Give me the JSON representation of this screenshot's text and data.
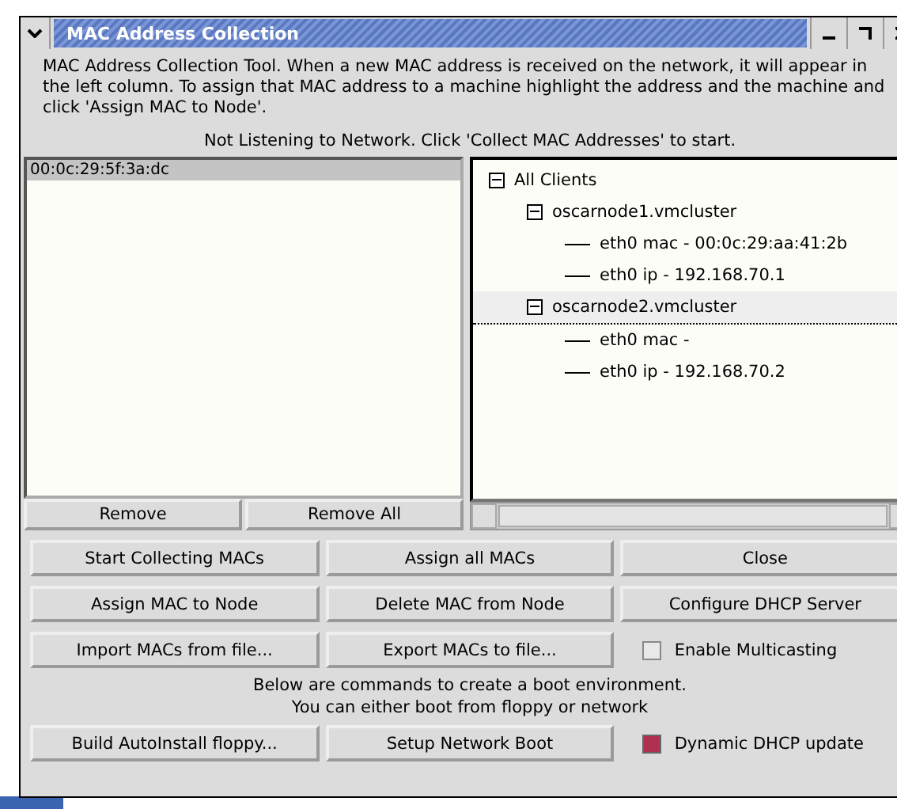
{
  "window": {
    "title": "MAC Address Collection"
  },
  "intro": "MAC Address Collection Tool.  When a new MAC address is received on the network, it will appear in the left column.  To assign that MAC address to a machine highlight the address and the machine and click 'Assign MAC to Node'.",
  "status": "Not Listening to Network. Click 'Collect MAC Addresses' to start.",
  "mac_list": [
    {
      "label": "00:0c:29:5f:3a:dc",
      "selected": true
    }
  ],
  "list_buttons": [
    "Remove",
    "Remove All"
  ],
  "tree": [
    {
      "label": "All Clients",
      "expanded": true,
      "selected": false,
      "children": [
        {
          "label": "oscarnode1.vmcluster",
          "expanded": true,
          "selected": false,
          "children": [
            {
              "label": "eth0 mac - 00:0c:29:aa:41:2b",
              "selected": false
            },
            {
              "label": "eth0 ip - 192.168.70.1",
              "selected": false
            }
          ]
        },
        {
          "label": "oscarnode2.vmcluster",
          "expanded": true,
          "selected": true,
          "children": [
            {
              "label": "eth0 mac -",
              "selected": false
            },
            {
              "label": "eth0 ip - 192.168.70.2",
              "selected": false
            }
          ]
        }
      ]
    }
  ],
  "grid": [
    {
      "kind": "button",
      "label": "Start Collecting MACs"
    },
    {
      "kind": "button",
      "label": "Assign all MACs"
    },
    {
      "kind": "button",
      "label": "Close"
    },
    {
      "kind": "button",
      "label": "Assign MAC to Node"
    },
    {
      "kind": "button",
      "label": "Delete MAC from Node"
    },
    {
      "kind": "button",
      "label": "Configure DHCP Server"
    },
    {
      "kind": "button",
      "label": "Import MACs from file..."
    },
    {
      "kind": "button",
      "label": "Export MACs to file..."
    },
    {
      "kind": "checkbox",
      "label": "Enable Multicasting",
      "checked": false
    }
  ],
  "boot_note": [
    "Below are commands to create a boot environment.",
    "You can either boot from floppy or network"
  ],
  "boot_row": [
    {
      "kind": "button",
      "label": "Build AutoInstall floppy..."
    },
    {
      "kind": "button",
      "label": "Setup Network Boot"
    },
    {
      "kind": "checkbox",
      "label": "Dynamic DHCP update",
      "checked": true
    }
  ]
}
